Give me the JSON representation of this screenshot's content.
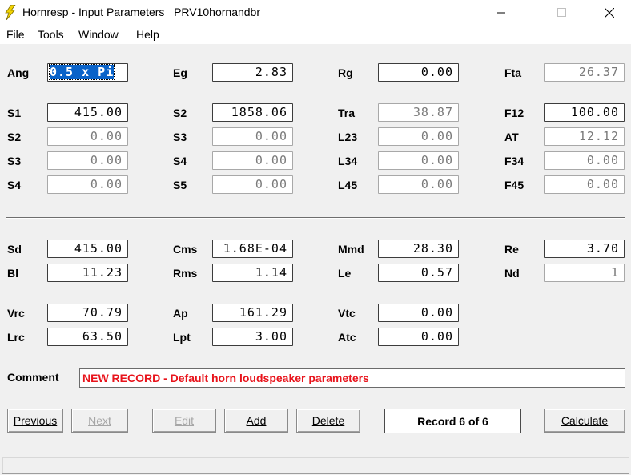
{
  "window": {
    "title": "Hornresp - Input Parameters   PRV10hornandbr",
    "accent": "#f2d300"
  },
  "menu": {
    "file": "File",
    "tools": "Tools",
    "window": "Window",
    "help": "Help"
  },
  "params": {
    "ang": {
      "label": "Ang",
      "value": "0.5 x Pi"
    },
    "eg": {
      "label": "Eg",
      "value": "2.83"
    },
    "rg": {
      "label": "Rg",
      "value": "0.00"
    },
    "fta": {
      "label": "Fta",
      "value": "26.37"
    },
    "s1": {
      "label": "S1",
      "value": "415.00"
    },
    "s2a": {
      "label": "S2",
      "value": "1858.06"
    },
    "tra": {
      "label": "Tra",
      "value": "38.87"
    },
    "f12": {
      "label": "F12",
      "value": "100.00"
    },
    "s2b": {
      "label": "S2",
      "value": "0.00"
    },
    "s3a": {
      "label": "S3",
      "value": "0.00"
    },
    "l23": {
      "label": "L23",
      "value": "0.00"
    },
    "at": {
      "label": "AT",
      "value": "12.12"
    },
    "s3b": {
      "label": "S3",
      "value": "0.00"
    },
    "s4a": {
      "label": "S4",
      "value": "0.00"
    },
    "l34": {
      "label": "L34",
      "value": "0.00"
    },
    "f34": {
      "label": "F34",
      "value": "0.00"
    },
    "s4b": {
      "label": "S4",
      "value": "0.00"
    },
    "s5": {
      "label": "S5",
      "value": "0.00"
    },
    "l45": {
      "label": "L45",
      "value": "0.00"
    },
    "f45": {
      "label": "F45",
      "value": "0.00"
    },
    "sd": {
      "label": "Sd",
      "value": "415.00"
    },
    "cms": {
      "label": "Cms",
      "value": "1.68E-04"
    },
    "mmd": {
      "label": "Mmd",
      "value": "28.30"
    },
    "re": {
      "label": "Re",
      "value": "3.70"
    },
    "bl": {
      "label": "Bl",
      "value": "11.23"
    },
    "rms": {
      "label": "Rms",
      "value": "1.14"
    },
    "le": {
      "label": "Le",
      "value": "0.57"
    },
    "nd": {
      "label": "Nd",
      "value": "1"
    },
    "vrc": {
      "label": "Vrc",
      "value": "70.79"
    },
    "ap": {
      "label": "Ap",
      "value": "161.29"
    },
    "vtc": {
      "label": "Vtc",
      "value": "0.00"
    },
    "lrc": {
      "label": "Lrc",
      "value": "63.50"
    },
    "lpt": {
      "label": "Lpt",
      "value": "3.00"
    },
    "atc": {
      "label": "Atc",
      "value": "0.00"
    }
  },
  "comment": {
    "label": "Comment",
    "value": "NEW RECORD - Default horn loudspeaker parameters",
    "color": "#e8141c"
  },
  "buttons": {
    "previous": "Previous",
    "next": "Next",
    "edit": "Edit",
    "add": "Add",
    "delete": "Delete",
    "calculate": "Calculate"
  },
  "record": "Record 6 of 6"
}
